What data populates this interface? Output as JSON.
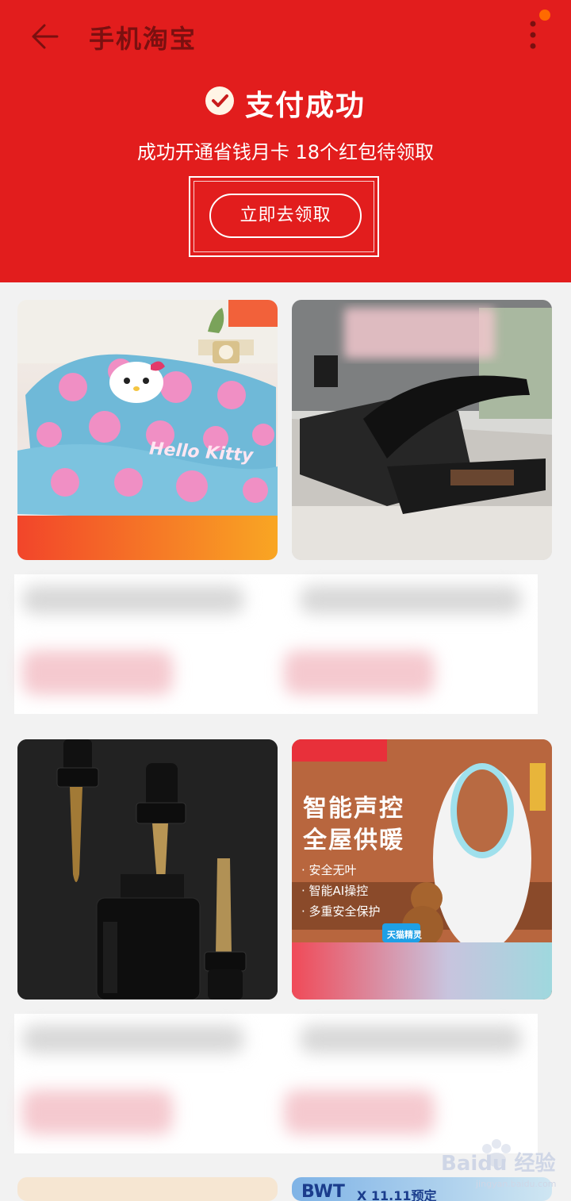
{
  "topbar": {
    "title": "手机淘宝"
  },
  "payment": {
    "status": "支付成功",
    "subtitle": "成功开通省钱月卡 18个红包待领取",
    "claim_button": "立即去领取"
  },
  "products": [
    {
      "name": "hello-kitty-pillow",
      "printed_text": "Hello Kitty"
    },
    {
      "name": "storage-bed"
    },
    {
      "name": "serum-bottles"
    },
    {
      "name": "bladeless-heater",
      "headline_1": "智能声控",
      "headline_2": "全屋供暖",
      "features": [
        "· 安全无叶",
        "· 智能AI操控",
        "· 多重安全保护"
      ],
      "badge": "天猫精灵"
    },
    {
      "name": "partial-card-left"
    },
    {
      "name": "bwt-card",
      "brand": "BWT",
      "tag": "X 11.11预定"
    }
  ],
  "watermark": {
    "brand": "Baidu 经验",
    "url": "jingyan.baidu.com"
  },
  "colors": {
    "header_red": "#e21d1d",
    "title_dark": "#7a1010",
    "badge_orange": "#ff6a00"
  }
}
